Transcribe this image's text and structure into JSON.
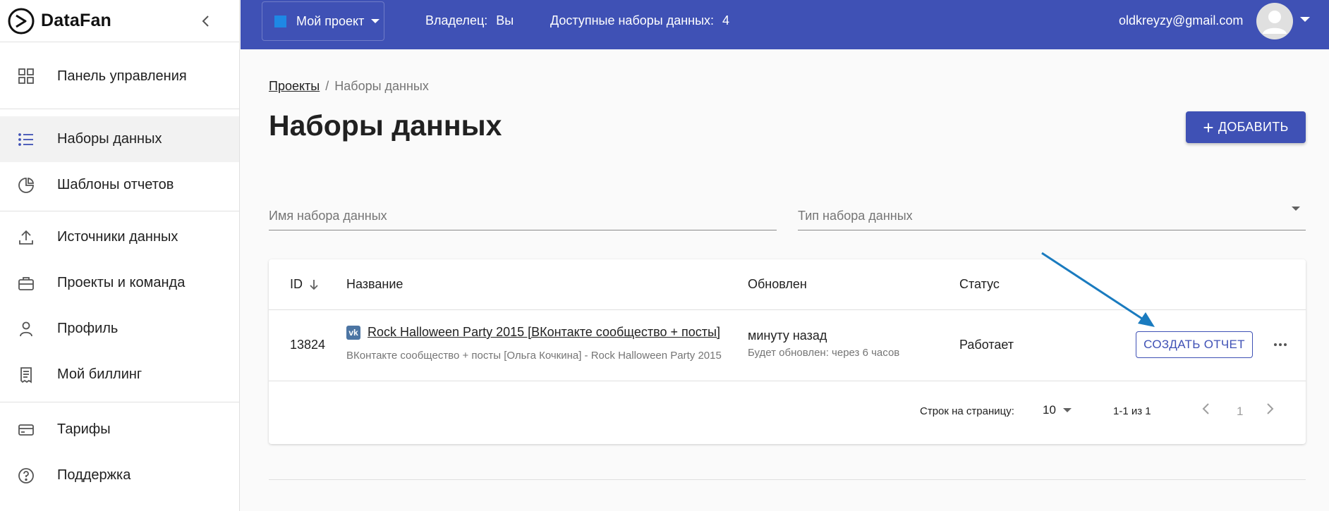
{
  "app": {
    "brand": "DataFan"
  },
  "sidebar": {
    "items": [
      {
        "label": "Панель управления"
      },
      {
        "label": "Наборы данных"
      },
      {
        "label": "Шаблоны отчетов"
      },
      {
        "label": "Источники данных"
      },
      {
        "label": "Проекты и команда"
      },
      {
        "label": "Профиль"
      },
      {
        "label": "Мой биллинг"
      },
      {
        "label": "Тарифы"
      },
      {
        "label": "Поддержка"
      }
    ],
    "active": "Наборы данных"
  },
  "topbar": {
    "project": "Мой проект",
    "owner_label": "Владелец:",
    "owner_value": "Вы",
    "datasets_label": "Доступные наборы данных:",
    "datasets_value": "4",
    "email": "oldkreyzy@gmail.com"
  },
  "breadcrumb": {
    "parent": "Проекты",
    "current": "Наборы данных"
  },
  "page": {
    "title": "Наборы данных",
    "add_button": "ДОБАВИТЬ"
  },
  "filters": {
    "name_placeholder": "Имя набора данных",
    "type_placeholder": "Тип набора данных"
  },
  "table": {
    "headers": {
      "id": "ID",
      "name": "Название",
      "updated": "Обновлен",
      "status": "Статус"
    },
    "rows": [
      {
        "id": "13824",
        "name": "Rock Halloween Party 2015 [ВКонтакте сообщество + посты]",
        "description": "ВКонтакте сообщество + посты [Ольга Кочкина] - Rock Halloween Party 2015",
        "updated": "минуту назад",
        "next_update": "Будет обновлен: через 6 часов",
        "status": "Работает",
        "action": "СОЗДАТЬ ОТЧЕТ"
      }
    ]
  },
  "pagination": {
    "rows_label": "Строк на страницу:",
    "rows_value": "10",
    "range": "1-1 из 1",
    "page": "1"
  },
  "colors": {
    "primary": "#3f51b5",
    "vk": "#4c75a3",
    "arrow": "#1a7bbf"
  }
}
